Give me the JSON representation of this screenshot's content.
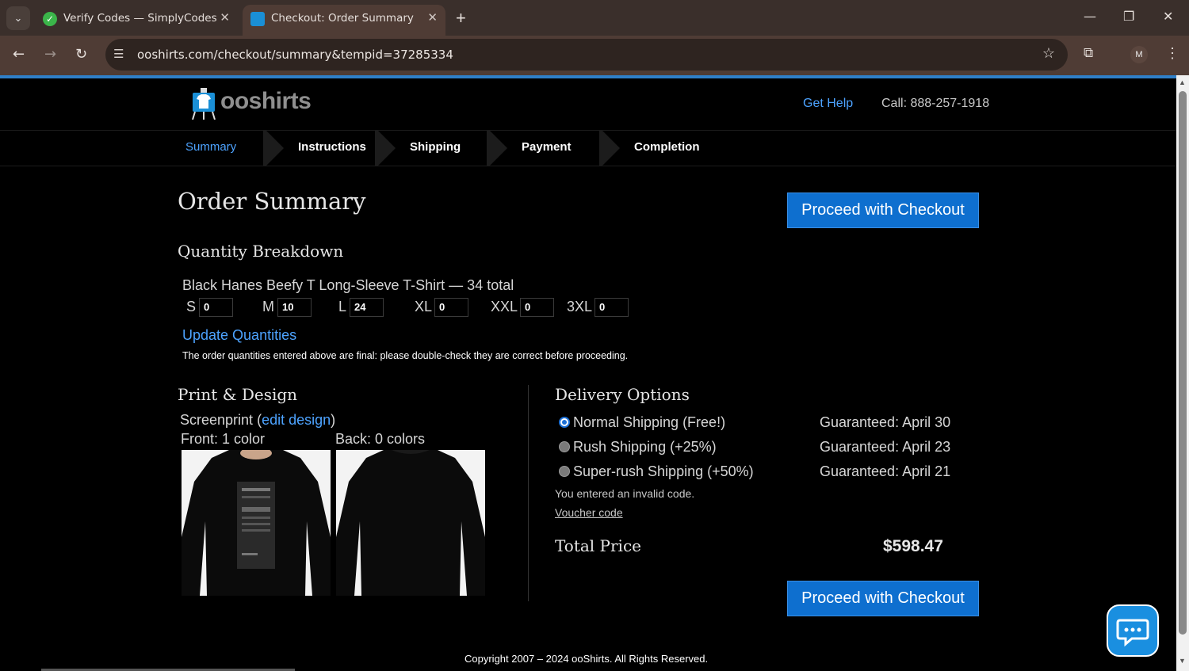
{
  "browser": {
    "tabs": [
      {
        "title": "Verify Codes — SimplyCodes",
        "active": false
      },
      {
        "title": "Checkout: Order Summary",
        "active": true
      }
    ],
    "url": "ooshirts.com/checkout/summary&tempid=37285334",
    "profile_initial": "M"
  },
  "header": {
    "logo_text": "ooshirts",
    "help_label": "Get Help",
    "call_text": "Call: 888-257-1918"
  },
  "steps": [
    "Summary",
    "Instructions",
    "Shipping",
    "Payment",
    "Completion"
  ],
  "order": {
    "title": "Order Summary",
    "checkout_label": "Proceed with Checkout",
    "quantity_heading": "Quantity Breakdown",
    "product_line": "Black Hanes Beefy T Long-Sleeve T-Shirt — 34 total",
    "sizes": [
      {
        "label": "S",
        "qty": "0"
      },
      {
        "label": "M",
        "qty": "10"
      },
      {
        "label": "L",
        "qty": "24"
      },
      {
        "label": "XL",
        "qty": "0"
      },
      {
        "label": "XXL",
        "qty": "0"
      },
      {
        "label": "3XL",
        "qty": "0"
      }
    ],
    "update_label": "Update Quantities",
    "final_note": "The order quantities entered above are final: please double-check they are correct before proceeding."
  },
  "print_design": {
    "heading": "Print & Design",
    "method": "Screenprint",
    "edit_link": "edit design",
    "front": "Front: 1 color",
    "back": "Back: 0 colors"
  },
  "delivery": {
    "heading": "Delivery Options",
    "options": [
      {
        "label": "Normal Shipping (Free!)",
        "guarantee": "Guaranteed: April 30",
        "selected": true
      },
      {
        "label": "Rush Shipping (+25%)",
        "guarantee": "Guaranteed: April 23",
        "selected": false
      },
      {
        "label": "Super-rush Shipping (+50%)",
        "guarantee": "Guaranteed: April 21",
        "selected": false
      }
    ],
    "invalid_code": "You entered an invalid code.",
    "voucher_label": "Voucher code",
    "total_label": "Total Price",
    "total_value": "$598.47"
  },
  "footer": "Copyright 2007 – 2024 ooShirts. All Rights Reserved.",
  "colors": {
    "accent": "#0e6fcf",
    "link": "#4da3ff"
  }
}
